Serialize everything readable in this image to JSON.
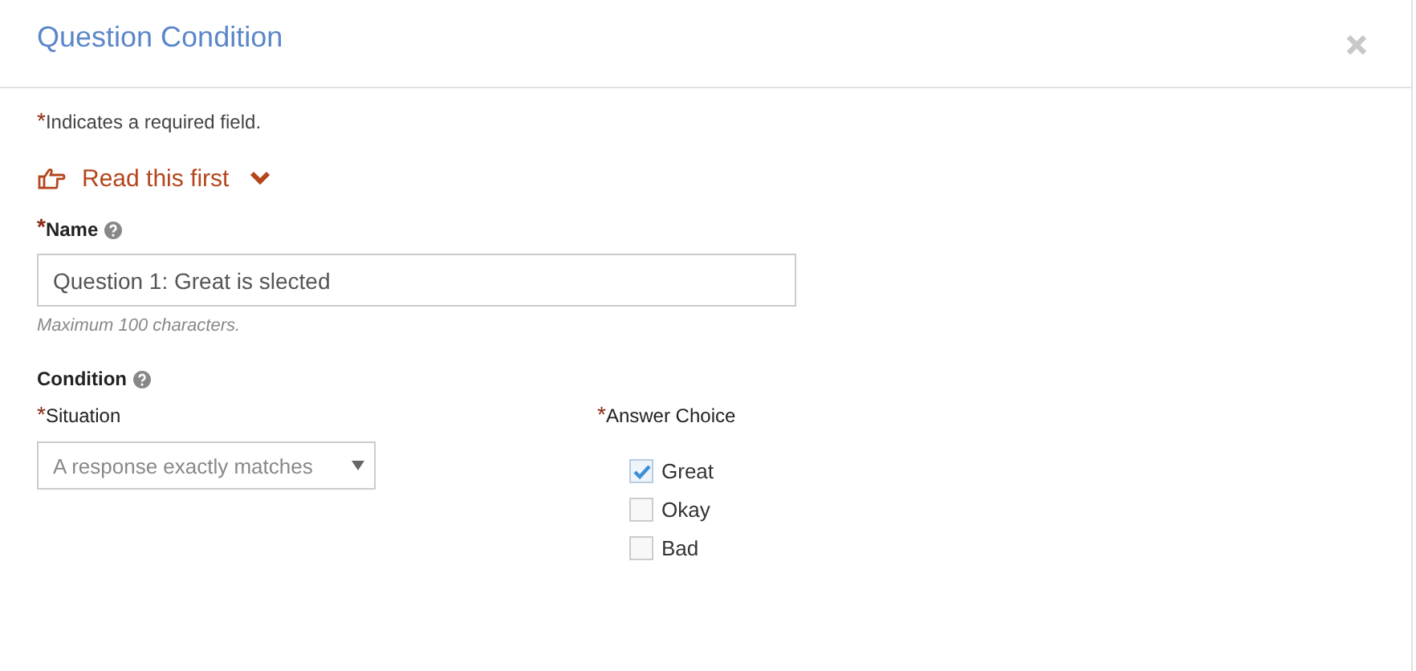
{
  "dialog": {
    "title": "Question Condition"
  },
  "required_note": {
    "marker": "*",
    "text": "Indicates a required field."
  },
  "read_first": {
    "label": "Read this first",
    "expanded": false
  },
  "name_field": {
    "marker": "*",
    "label": "Name",
    "value": "Question 1: Great is slected",
    "help": "Maximum 100 characters."
  },
  "condition": {
    "label": "Condition"
  },
  "situation": {
    "marker": "*",
    "label": "Situation",
    "value": "A response exactly matches"
  },
  "answer_choice": {
    "marker": "*",
    "label": "Answer Choice",
    "options": [
      {
        "label": "Great",
        "checked": true
      },
      {
        "label": "Okay",
        "checked": false
      },
      {
        "label": "Bad",
        "checked": false
      }
    ]
  }
}
